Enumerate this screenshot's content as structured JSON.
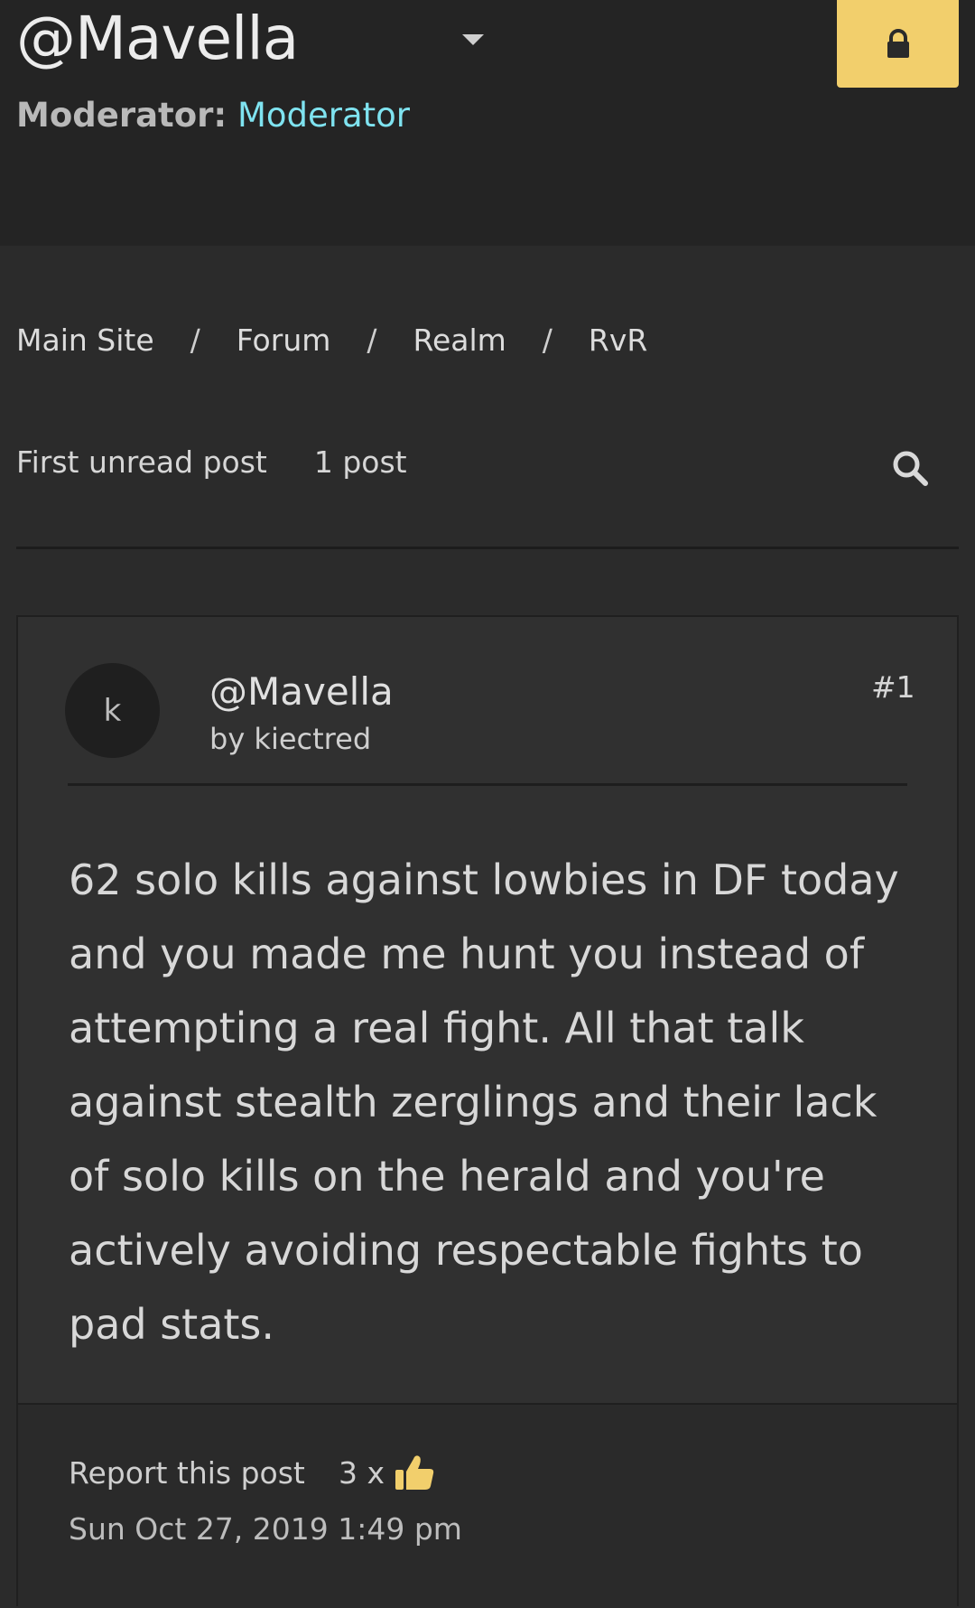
{
  "header": {
    "topic_title": "@Mavella",
    "moderator_label": "Moderator:",
    "moderator_name": "Moderator"
  },
  "breadcrumb": {
    "items": [
      "Main Site",
      "Forum",
      "Realm",
      "RvR"
    ],
    "separator": "/"
  },
  "actions": {
    "first_unread": "First unread post",
    "post_count": "1 post"
  },
  "post": {
    "avatar_initial": "k",
    "title": "@Mavella",
    "by_label": "by",
    "author": "kiectred",
    "number": "#1",
    "body": "62 solo kills against lowbies in DF today and you made me hunt you instead of attempting a real fight. All that talk against stealth zerglings and their lack of solo kills on the herald and you're actively avoiding respectable fights to pad stats.",
    "report_label": "Report this post",
    "likes": "3 x",
    "date": "Sun Oct 27, 2019 1:49 pm"
  },
  "icons": {
    "caret": "chevron-down-icon",
    "lock": "lock-icon",
    "search": "search-icon",
    "like": "thumbs-up-icon"
  },
  "colors": {
    "lock_button": "#f2cf6c",
    "moderator_link": "#7fe3f0",
    "thumbs_up": "#f2cf6c"
  }
}
